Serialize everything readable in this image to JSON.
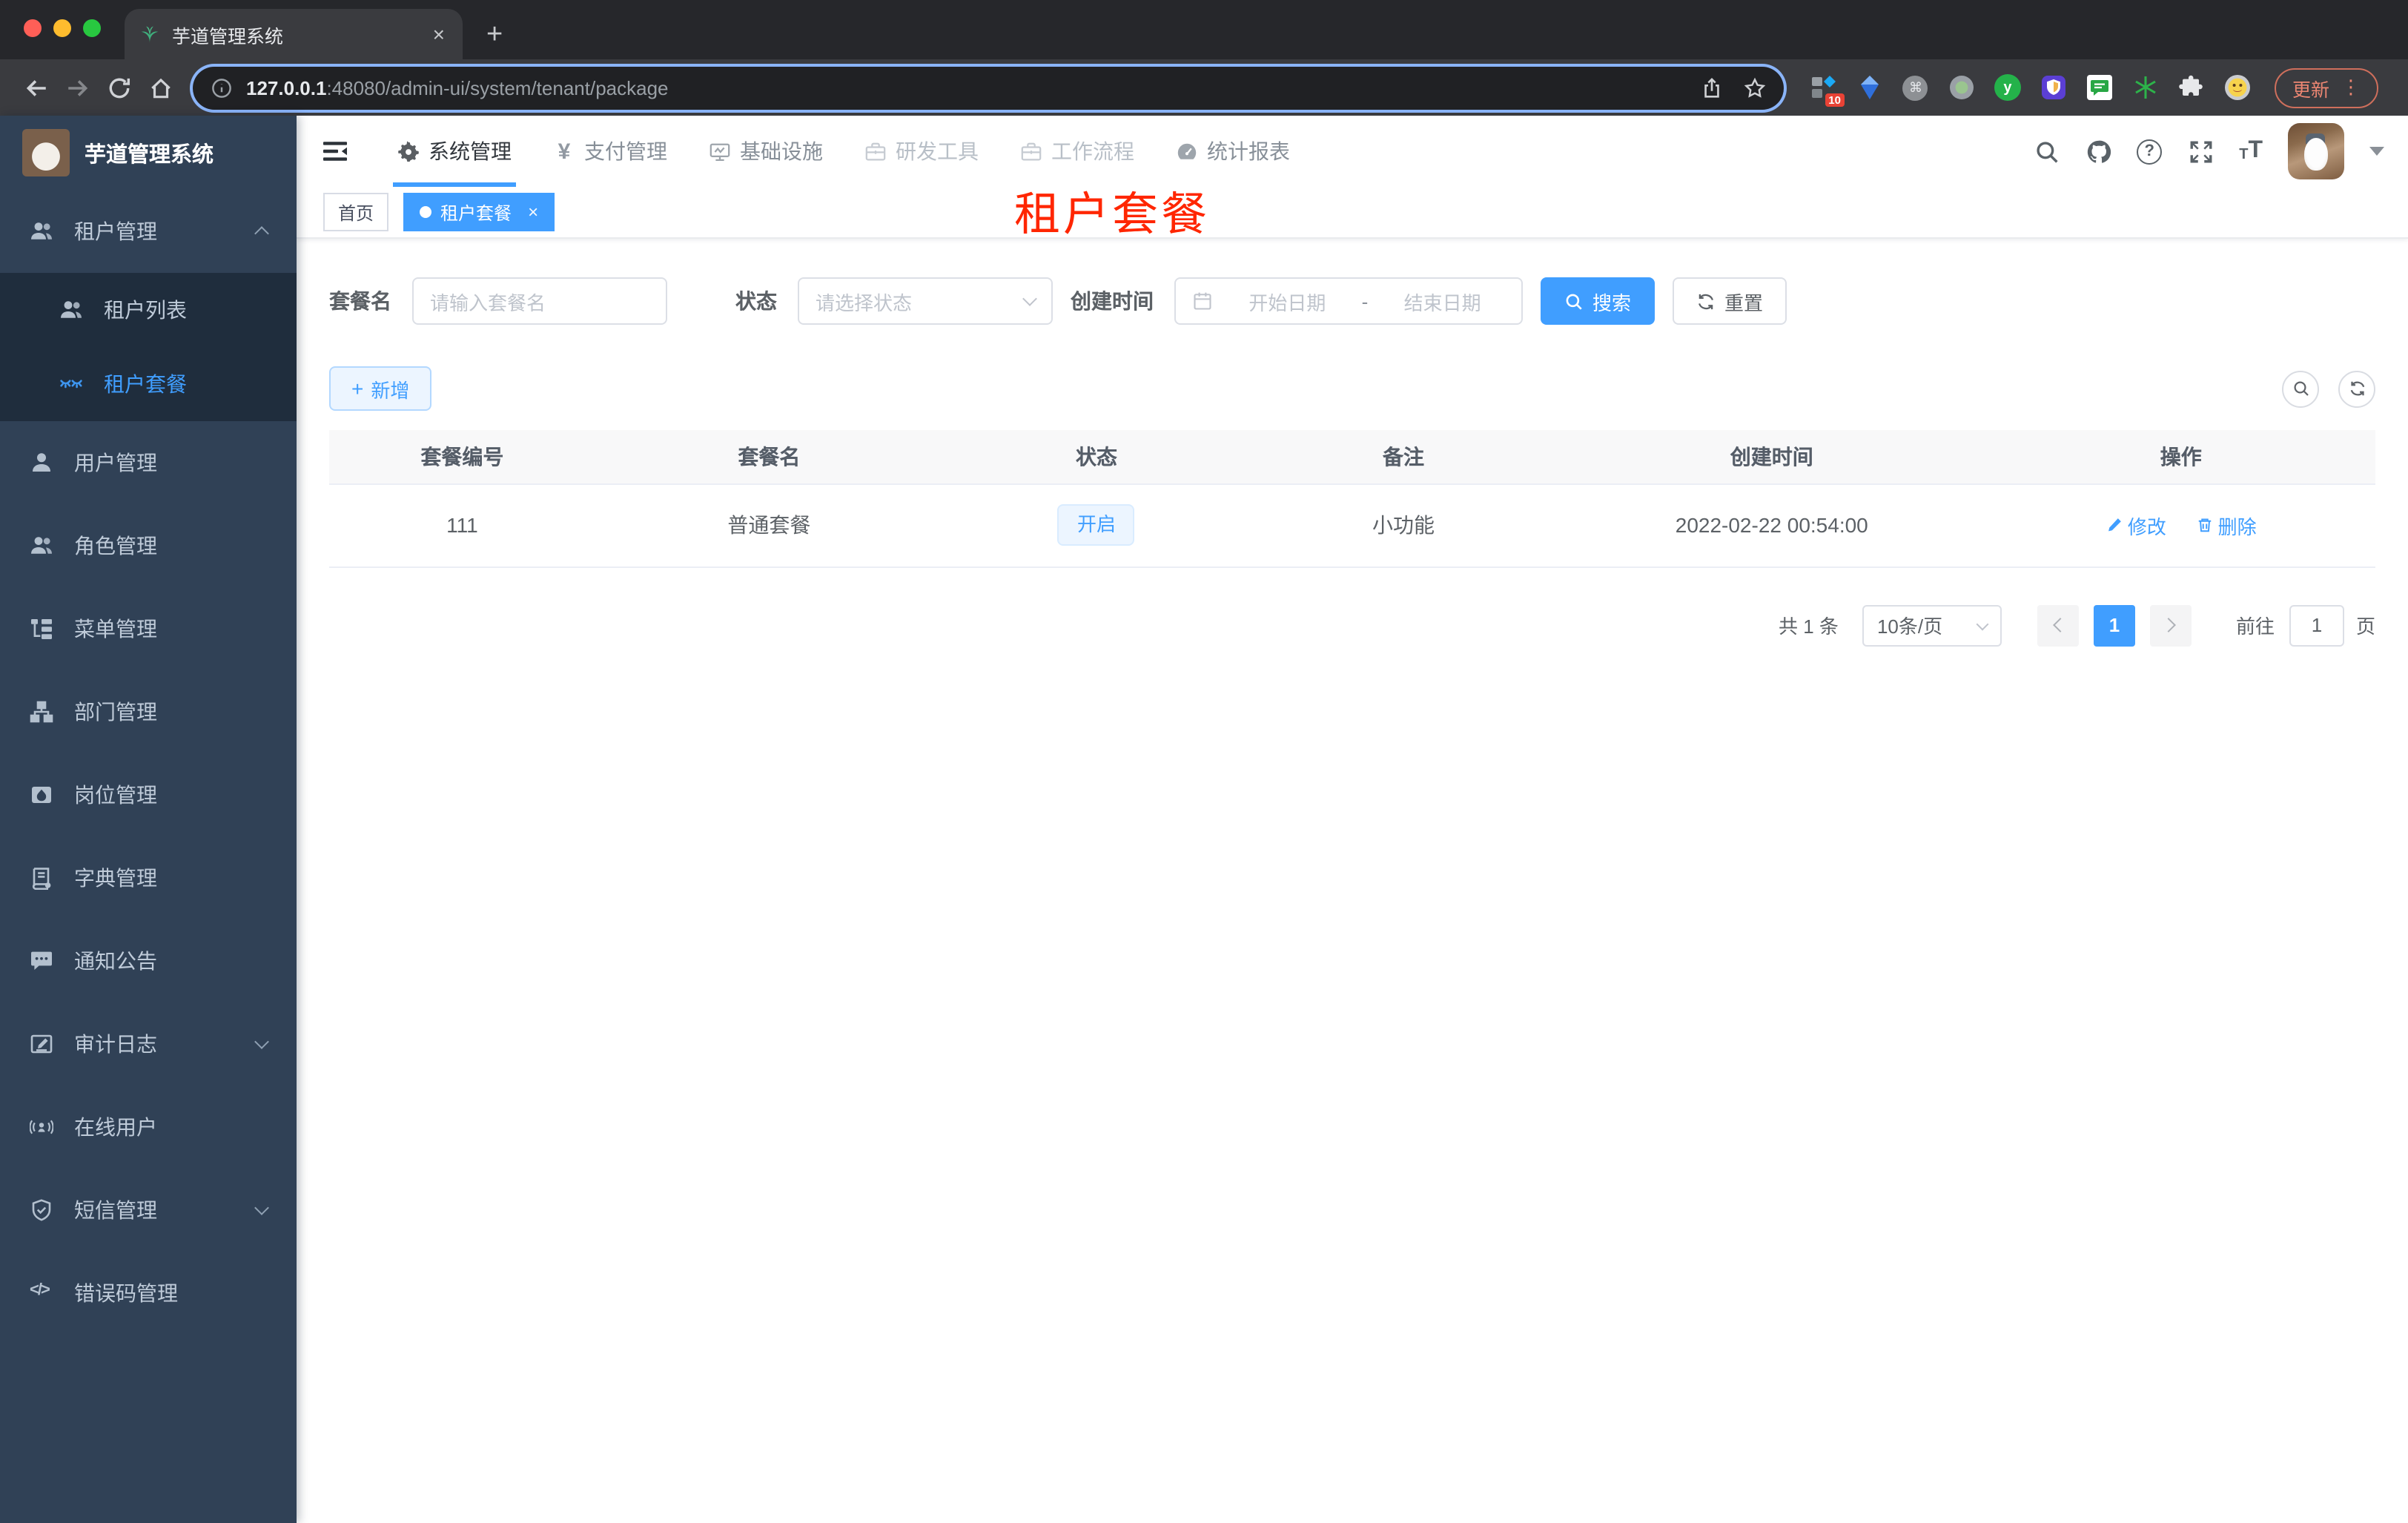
{
  "browser": {
    "tab_title": "芋道管理系统",
    "url_host": "127.0.0.1",
    "url_rest": ":48080/admin-ui/system/tenant/package",
    "ext_badge": "10",
    "update_label": "更新"
  },
  "glyphs": {
    "close": "×",
    "newtab": "+",
    "dots": "⋮",
    "cmd": "⌘",
    "y_letter": "y",
    "question": "?",
    "yen": "¥",
    "code": "</>",
    "t_small": "T",
    "t_large": "T",
    "plus": "+"
  },
  "sidebar": {
    "logo_title": "芋道管理系统",
    "items": [
      {
        "label": "租户管理"
      },
      {
        "label": "租户列表"
      },
      {
        "label": "租户套餐"
      },
      {
        "label": "用户管理"
      },
      {
        "label": "角色管理"
      },
      {
        "label": "菜单管理"
      },
      {
        "label": "部门管理"
      },
      {
        "label": "岗位管理"
      },
      {
        "label": "字典管理"
      },
      {
        "label": "通知公告"
      },
      {
        "label": "审计日志"
      },
      {
        "label": "在线用户"
      },
      {
        "label": "短信管理"
      },
      {
        "label": "错误码管理"
      }
    ]
  },
  "top_menu": {
    "items": [
      {
        "label": "系统管理"
      },
      {
        "label": "支付管理"
      },
      {
        "label": "基础设施"
      },
      {
        "label": "研发工具"
      },
      {
        "label": "工作流程"
      },
      {
        "label": "统计报表"
      }
    ]
  },
  "tags": {
    "home": "首页",
    "active": "租户套餐"
  },
  "annotation": {
    "text": "租户套餐",
    "color": "#ff2600"
  },
  "filters": {
    "name_label": "套餐名",
    "name_placeholder": "请输入套餐名",
    "status_label": "状态",
    "status_placeholder": "请选择状态",
    "date_label": "创建时间",
    "date_start": "开始日期",
    "date_sep": "-",
    "date_end": "结束日期",
    "search_label": "搜索",
    "reset_label": "重置"
  },
  "toolbar": {
    "add_label": "新增"
  },
  "table": {
    "headers": [
      "套餐编号",
      "套餐名",
      "状态",
      "备注",
      "创建时间",
      "操作"
    ],
    "rows": [
      {
        "id": "111",
        "name": "普通套餐",
        "status": "开启",
        "remark": "小功能",
        "created": "2022-02-22 00:54:00",
        "edit_label": "修改",
        "delete_label": "删除"
      }
    ]
  },
  "pagination": {
    "total": "共 1 条",
    "size": "10条/页",
    "page": "1",
    "goto_label": "前往",
    "goto_value": "1",
    "unit_label": "页"
  },
  "colors": {
    "accent": "#409eff",
    "annotation_red": "#ff2600",
    "sidebar_bg": "#304156",
    "submenu_bg": "#1f2d3d"
  }
}
